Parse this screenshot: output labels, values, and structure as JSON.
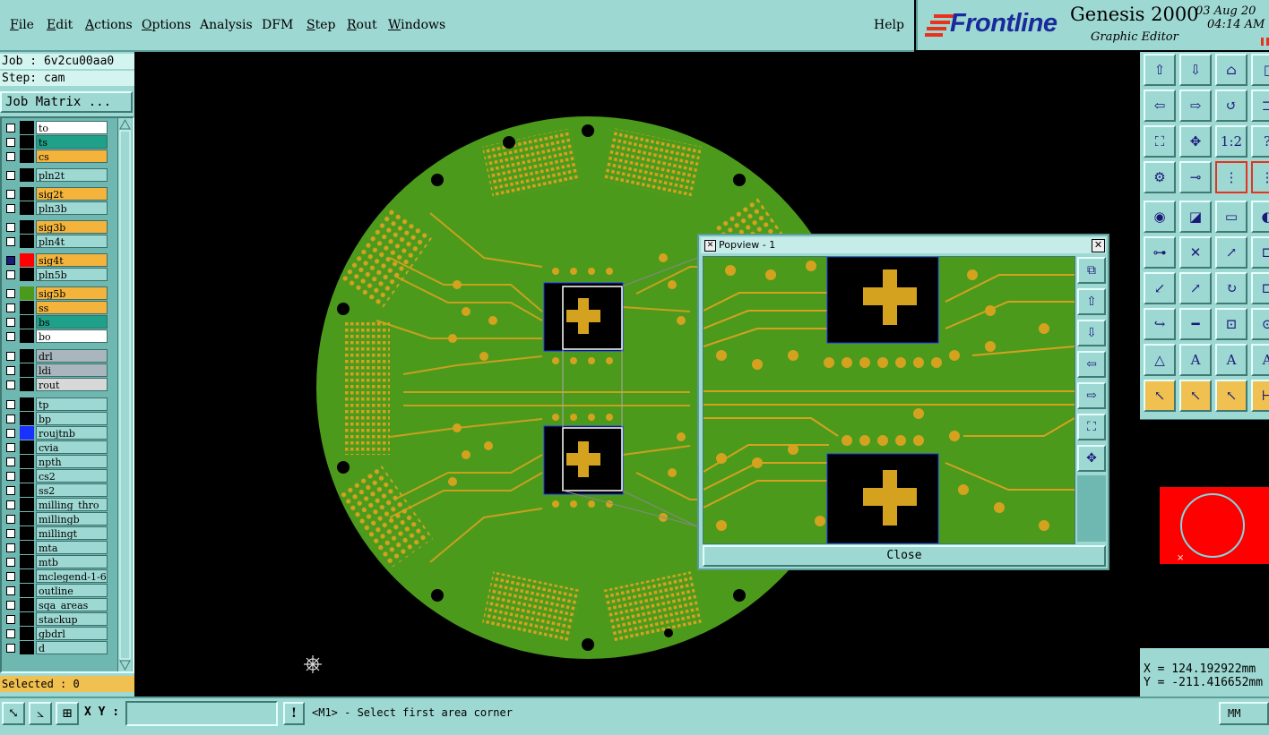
{
  "menu": {
    "items": [
      {
        "label": "File",
        "u": "F",
        "rest": "ile"
      },
      {
        "label": "Edit",
        "u": "E",
        "rest": "dit"
      },
      {
        "label": "Actions",
        "u": "A",
        "rest": "ctions"
      },
      {
        "label": "Options",
        "u": "O",
        "rest": "ptions"
      },
      {
        "label": "Analysis",
        "u": "",
        "rest": "Analysis"
      },
      {
        "label": "DFM",
        "u": "",
        "rest": "DFM"
      },
      {
        "label": "Step",
        "u": "S",
        "rest": "tep"
      },
      {
        "label": "Rout",
        "u": "R",
        "rest": "out"
      },
      {
        "label": "Windows",
        "u": "W",
        "rest": "indows"
      }
    ],
    "help": "Help"
  },
  "brand": {
    "logo": "Frontline",
    "product": "Genesis 2000",
    "subtitle": "Graphic Editor",
    "date": "03 Aug 20",
    "time": "04:14 AM"
  },
  "job": {
    "job_line": "Job : 6v2cu00aa0",
    "step_line": "Step: cam",
    "matrix_button": "Job Matrix ..."
  },
  "layers": [
    {
      "name": "to",
      "color": "#ffffff",
      "swatch": "#000000"
    },
    {
      "name": "ts",
      "color": "#1fa088",
      "swatch": "#000000"
    },
    {
      "name": "cs",
      "color": "#f4b43c",
      "swatch": "#000000"
    },
    {
      "name": "pln2t",
      "color": "#9ed8d2",
      "swatch": "#000000"
    },
    {
      "name": "sig2t",
      "color": "#f4b43c",
      "swatch": "#000000"
    },
    {
      "name": "pln3b",
      "color": "#9ed8d2",
      "swatch": "#000000"
    },
    {
      "name": "sig3b",
      "color": "#f4b43c",
      "swatch": "#000000"
    },
    {
      "name": "pln4t",
      "color": "#9ed8d2",
      "swatch": "#000000"
    },
    {
      "name": "sig4t",
      "color": "#f4b43c",
      "swatch": "#ff0000",
      "active": true
    },
    {
      "name": "pln5b",
      "color": "#9ed8d2",
      "swatch": "#000000"
    },
    {
      "name": "sig5b",
      "color": "#f4b43c",
      "swatch": "#4c9a1c"
    },
    {
      "name": "ss",
      "color": "#f4b43c",
      "swatch": "#000000"
    },
    {
      "name": "bs",
      "color": "#1fa088",
      "swatch": "#000000"
    },
    {
      "name": "bo",
      "color": "#ffffff",
      "swatch": "#000000"
    },
    {
      "name": "drl",
      "color": "#aab6be",
      "swatch": "#000000"
    },
    {
      "name": "ldi",
      "color": "#aab6be",
      "swatch": "#000000"
    },
    {
      "name": "rout",
      "color": "#d8d8d8",
      "swatch": "#000000"
    },
    {
      "name": "tp",
      "color": "#9ed8d2",
      "swatch": "#000000"
    },
    {
      "name": "bp",
      "color": "#9ed8d2",
      "swatch": "#000000"
    },
    {
      "name": "roujtnb",
      "color": "#9ed8d2",
      "swatch": "#1a30ff"
    },
    {
      "name": "cvia",
      "color": "#9ed8d2",
      "swatch": "#000000"
    },
    {
      "name": "npth",
      "color": "#9ed8d2",
      "swatch": "#000000"
    },
    {
      "name": "cs2",
      "color": "#9ed8d2",
      "swatch": "#000000"
    },
    {
      "name": "ss2",
      "color": "#9ed8d2",
      "swatch": "#000000"
    },
    {
      "name": "milling_thro",
      "color": "#9ed8d2",
      "swatch": "#000000"
    },
    {
      "name": "millingb",
      "color": "#9ed8d2",
      "swatch": "#000000"
    },
    {
      "name": "millingt",
      "color": "#9ed8d2",
      "swatch": "#000000"
    },
    {
      "name": "mta",
      "color": "#9ed8d2",
      "swatch": "#000000"
    },
    {
      "name": "mtb",
      "color": "#9ed8d2",
      "swatch": "#000000"
    },
    {
      "name": "mclegend-1-6",
      "color": "#9ed8d2",
      "swatch": "#000000"
    },
    {
      "name": "outline",
      "color": "#9ed8d2",
      "swatch": "#000000"
    },
    {
      "name": "sqa_areas",
      "color": "#9ed8d2",
      "swatch": "#000000"
    },
    {
      "name": "stackup",
      "color": "#9ed8d2",
      "swatch": "#000000"
    },
    {
      "name": "gbdrl",
      "color": "#9ed8d2",
      "swatch": "#000000"
    },
    {
      "name": "d",
      "color": "#9ed8d2",
      "swatch": "#000000"
    }
  ],
  "selected": "Selected : 0",
  "popview": {
    "title": "Popview - 1",
    "close_label": "Close"
  },
  "coords": {
    "x": "X = 124.192922mm",
    "y": "Y = -211.416652mm"
  },
  "bottom": {
    "xy_label": "X Y :",
    "xy_value": "",
    "prompt": "<M1> - Select first area corner",
    "units": "MM"
  },
  "colors": {
    "panel": "#9ed8d2",
    "board_green": "#4c9a1c",
    "copper": "#d4a21f",
    "logo_red": "#e8321e",
    "logo_blue": "#1a2a9a"
  },
  "icons": [
    "zoom-home-icon",
    "zoom-in-icon",
    "pan-icon",
    "fit-icon",
    "measure-icon",
    "select-arrow-icon",
    "route-icon",
    "highlight-icon"
  ]
}
